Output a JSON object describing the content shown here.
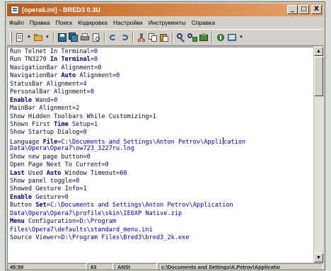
{
  "window": {
    "title": "[opera6.ini] - BRED3 0.3U",
    "controls": {
      "minimize": "_",
      "maximize": "□",
      "close": "X"
    }
  },
  "menubar": [
    "Файл",
    "Правка",
    "Поиск",
    "Кодировка",
    "Настройки",
    "Инструменты",
    "Справка"
  ],
  "toolbar": {
    "icons": [
      "new-file-icon",
      "open-file-icon",
      "save-icon",
      "save-all-icon",
      "print-icon",
      "print-preview-icon",
      "undo-icon",
      "redo-icon",
      "cut-icon",
      "copy-icon",
      "paste-icon",
      "find-icon",
      "replace-icon",
      "goto-icon",
      "tools-icon",
      "settings-icon"
    ]
  },
  "editor": {
    "lines": [
      [
        {
          "t": "Run Telnet In Terminal="
        },
        {
          "v": "0"
        }
      ],
      [
        {
          "t": "Run TN3270 "
        },
        {
          "b": "In Terminal"
        },
        {
          "t": "="
        },
        {
          "v": "0"
        }
      ],
      [
        {
          "t": "NavigationBar Alignment="
        },
        {
          "v": "0"
        }
      ],
      [
        {
          "t": "NavigationBar "
        },
        {
          "b": "Auto"
        },
        {
          "t": " Alignment="
        },
        {
          "v": "0"
        }
      ],
      [
        {
          "t": "StatusBar Alignment="
        },
        {
          "v": "4"
        }
      ],
      [
        {
          "t": "PersonalBar Alignment="
        },
        {
          "v": "0"
        }
      ],
      [
        {
          "b": "Enable"
        },
        {
          "t": " Wand="
        },
        {
          "v": "0"
        }
      ],
      [
        {
          "t": "MainBar Alignment="
        },
        {
          "v": "2"
        }
      ],
      [
        {
          "t": "Show Hidden Toolbars While Customizing="
        },
        {
          "v": "1"
        }
      ],
      [
        {
          "t": "Shown First "
        },
        {
          "b": "Time"
        },
        {
          "t": " Setup="
        },
        {
          "v": "1"
        }
      ],
      [
        {
          "t": "Show Startup Dialog="
        },
        {
          "v": "0"
        }
      ],
      [
        {
          "t": "Language "
        },
        {
          "b": "File"
        },
        {
          "t": "="
        },
        {
          "v": "C:\\Documents and Settings\\Anton Petrov\\Appli"
        },
        {
          "cursor": true
        },
        {
          "v": "cation"
        }
      ],
      [
        {
          "v": "Data\\Opera\\Opera7\\ow723_3227ru.lng"
        }
      ],
      [
        {
          "t": "Show new page button="
        },
        {
          "v": "0"
        }
      ],
      [
        {
          "t": "Open Page Next To Current="
        },
        {
          "v": "0"
        }
      ],
      [
        {
          "b": "Last"
        },
        {
          "t": " Used "
        },
        {
          "b": "Auto"
        },
        {
          "t": " Window Timeout="
        },
        {
          "v": "60"
        }
      ],
      [
        {
          "t": "Show panel toggle="
        },
        {
          "v": "0"
        }
      ],
      [
        {
          "t": "Showed Gesture Info="
        },
        {
          "v": "1"
        }
      ],
      [
        {
          "b": "Enable"
        },
        {
          "t": " Gesture="
        },
        {
          "v": "0"
        }
      ],
      [
        {
          "t": "Button "
        },
        {
          "b": "Set"
        },
        {
          "t": "="
        },
        {
          "v": "C:\\Documents and Settings\\Anton Petrov\\Application"
        }
      ],
      [
        {
          "v": "Data\\Opera\\Opera7\\profile\\skin\\IE6XP Native.zip"
        }
      ],
      [
        {
          "b": "Menu"
        },
        {
          "t": " Configuration="
        },
        {
          "v": "D:\\Program"
        }
      ],
      [
        {
          "v": "Files\\Opera7\\defaults\\standard_menu.ini"
        }
      ],
      [
        {
          "t": "Source Viewer="
        },
        {
          "v": "D:\\Program Files\\Bred3\\bred3_2k.exe"
        }
      ]
    ]
  },
  "scrollbar": {
    "up": "▲",
    "down": "▼"
  },
  "statusbar": {
    "position": "45:59",
    "code": "63",
    "encoding": "ANSI",
    "path": "c:\\Documents and Settings\\A.Petrov\\Applicatio"
  }
}
